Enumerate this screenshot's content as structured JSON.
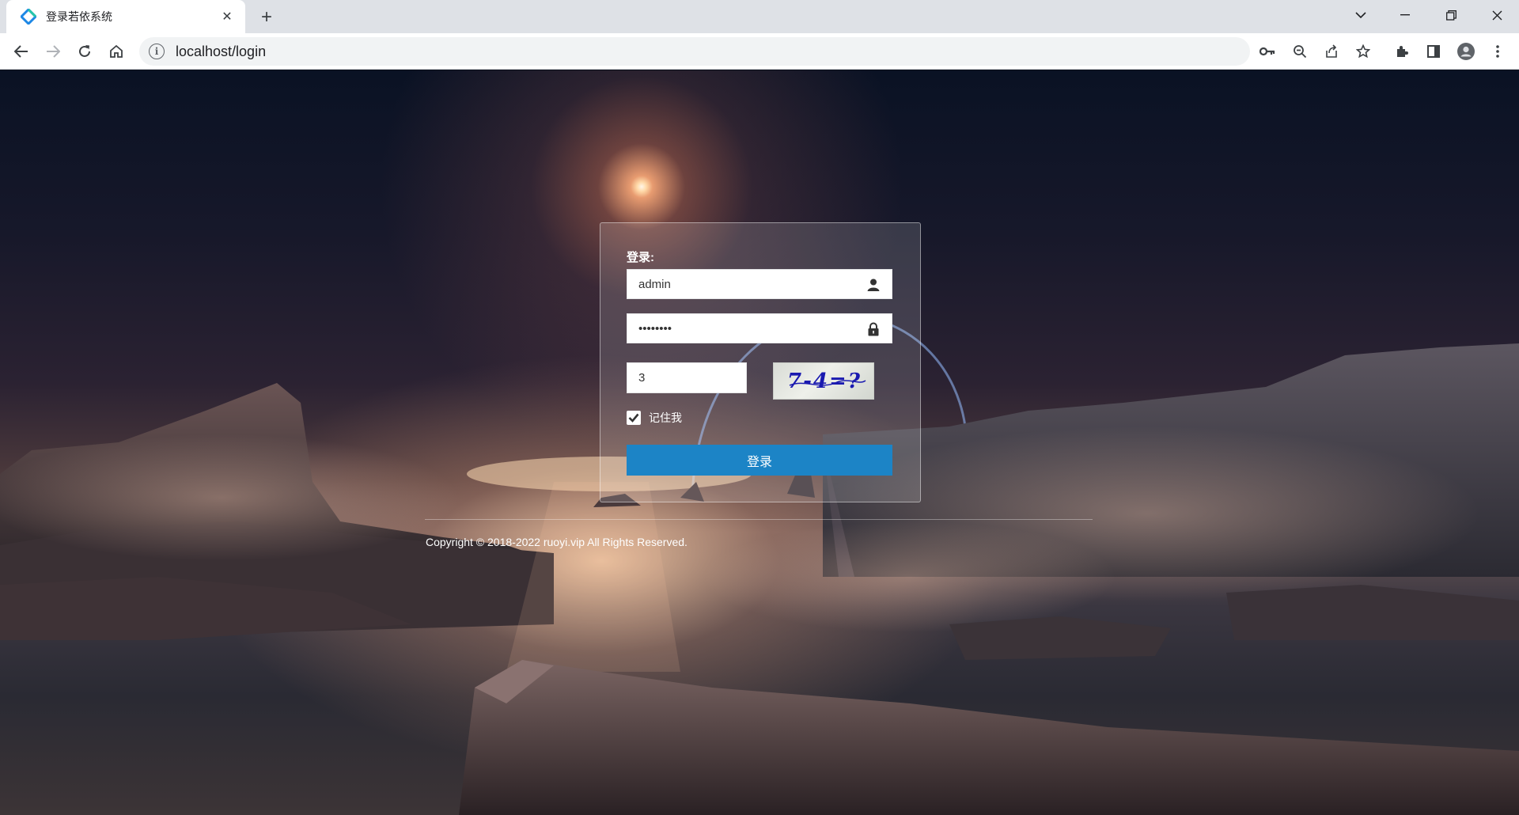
{
  "browser": {
    "tab_title": "登录若依系统",
    "tab_close": "✕",
    "new_tab": "+",
    "url": "localhost/login"
  },
  "login": {
    "heading": "登录:",
    "username_value": "admin",
    "password_value": "••••••••",
    "captcha_value": "3",
    "captcha_text": "7-4=?",
    "remember_label": "记住我",
    "remember_checked": true,
    "submit_label": "登录"
  },
  "footer": {
    "copyright": "Copyright © 2018-2022 ruoyi.vip All Rights Reserved."
  },
  "colors": {
    "login_button": "#1c84c6",
    "chrome_tabstrip": "#dee1e6",
    "omnibox": "#f1f3f4"
  }
}
